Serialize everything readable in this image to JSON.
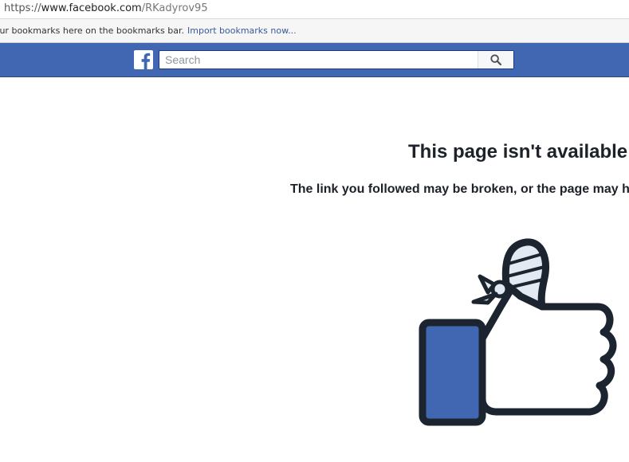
{
  "browser": {
    "url": {
      "scheme": "https://",
      "host": "www.facebook.com",
      "path": "/RKadyrov95"
    },
    "bookmarks_bar": {
      "message": "our bookmarks here on the bookmarks bar.",
      "import_link": "Import bookmarks now..."
    }
  },
  "header": {
    "logo_icon": "facebook-f-icon",
    "search": {
      "placeholder": "Search",
      "value": "",
      "button_icon": "magnifier-icon"
    },
    "colors": {
      "brand": "#4267b2",
      "border": "#29487d"
    }
  },
  "main": {
    "title": "This page isn't available",
    "subtitle": "The link you followed may be broken, or the page may h",
    "illustration_icon": "broken-thumb-up-icon",
    "colors": {
      "text": "#1d2129",
      "thumb_cuff": "#4267b2",
      "outline": "#1c2430",
      "bandage": "#e3e9f2"
    }
  }
}
